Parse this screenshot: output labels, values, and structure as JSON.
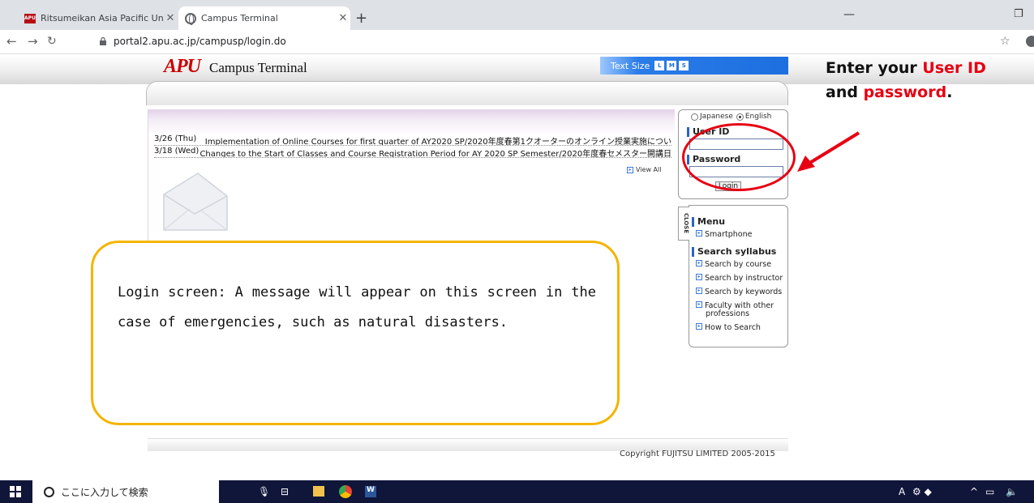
{
  "browser": {
    "tabs": [
      {
        "label": "Ritsumeikan Asia Pacific Universit",
        "favicon": "APU"
      },
      {
        "label": "Campus Terminal"
      }
    ],
    "new_tab": "+",
    "url": "portal2.apu.ac.jp/campusp/login.do"
  },
  "header": {
    "logo_mark": "APU",
    "logo_text": "Campus Terminal",
    "text_size_label": "Text Size",
    "text_size_options": [
      "L",
      "M",
      "S"
    ]
  },
  "news": {
    "items": [
      {
        "date": "3/26 (Thu)",
        "text": "Implementation of Online Courses for first quarter of AY2020 SP/2020年度春第1クオーターのオンライン授業実施につい"
      },
      {
        "date": "3/18 (Wed)",
        "text": "Changes to the Start of Classes and Course Registration Period for AY 2020 SP Semester/2020年度春セメスター開講日"
      }
    ],
    "view_all": "View All"
  },
  "login": {
    "lang_japanese": "Japanese",
    "lang_english": "English",
    "selected_language": "English",
    "user_id_label": "User ID",
    "user_id_value": "",
    "password_label": "Password",
    "password_value": "",
    "login_button": "Login"
  },
  "menu": {
    "close_tab": "CLOSE",
    "heading": "Menu",
    "items": [
      "Smartphone"
    ],
    "search_heading": "Search syllabus",
    "search_items": [
      "Search by course",
      "Search by instructor",
      "Search by keywords",
      "Faculty with other",
      "professions",
      "How to Search"
    ]
  },
  "annotation": {
    "line1_a": "Enter your ",
    "line1_b": "User ID",
    "line2_a": "and ",
    "line2_b": "password",
    "line2_c": ".",
    "callout": "Login screen: A message will appear on this screen in the case of emergencies, such as natural disasters.",
    "highlight_color": "#e60012",
    "callout_border": "#f5b400"
  },
  "footer": {
    "copyright": "Copyright FUJITSU LIMITED 2005-2015"
  },
  "taskbar": {
    "search_placeholder": "ここに入力して検索",
    "tray_ime": "A"
  }
}
